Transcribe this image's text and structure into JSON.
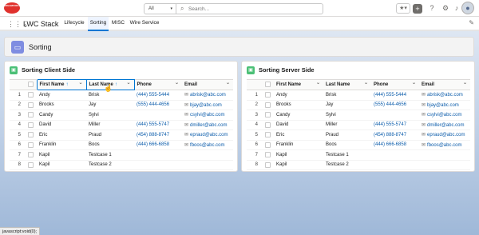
{
  "global_header": {
    "logo_text": "DREAMFORCE",
    "search_scope": "All",
    "search_placeholder": "Search...",
    "icons": [
      "star-icon",
      "chevron-down-icon",
      "plus-icon",
      "help-icon",
      "gear-icon",
      "bell-icon",
      "avatar"
    ]
  },
  "app_nav": {
    "app_name": "LWC Stack",
    "tabs": [
      {
        "label": "Lifecycle",
        "active": false
      },
      {
        "label": "Sorting",
        "active": true
      },
      {
        "label": "MISC",
        "active": false
      },
      {
        "label": "Wire Service",
        "active": false
      }
    ]
  },
  "page_header": {
    "title": "Sorting"
  },
  "cards": [
    {
      "title": "Sorting Client Side",
      "columns": [
        {
          "label": "First Name",
          "sorted": true,
          "arrow": "↑"
        },
        {
          "label": "Last Name",
          "sorted": true,
          "arrow": "↑"
        },
        {
          "label": "Phone",
          "sorted": false,
          "arrow": ""
        },
        {
          "label": "Email",
          "sorted": false,
          "arrow": ""
        }
      ],
      "rows": [
        {
          "num": "1",
          "first": "Andy",
          "last": "Brisk",
          "phone": "(444) 555-5444",
          "email": "abrisk@abc.com"
        },
        {
          "num": "2",
          "first": "Brooks",
          "last": "Jay",
          "phone": "(555) 444-4656",
          "email": "bjay@abc.com"
        },
        {
          "num": "3",
          "first": "Candy",
          "last": "Sylvi",
          "phone": "",
          "email": "csylvi@abc.com"
        },
        {
          "num": "4",
          "first": "David",
          "last": "Miller",
          "phone": "(444) 555-5747",
          "email": "dmiller@abc.com"
        },
        {
          "num": "5",
          "first": "Eric",
          "last": "Praud",
          "phone": "(454) 888-8747",
          "email": "epraud@abc.com"
        },
        {
          "num": "6",
          "first": "Franklin",
          "last": "Boos",
          "phone": "(444) 666-6858",
          "email": "fboos@abc.com"
        },
        {
          "num": "7",
          "first": "Kapil",
          "last": "Testcase 1",
          "phone": "",
          "email": ""
        },
        {
          "num": "8",
          "first": "Kapil",
          "last": "Testcase 2",
          "phone": "",
          "email": ""
        }
      ]
    },
    {
      "title": "Sorting Server Side",
      "columns": [
        {
          "label": "First Name",
          "sorted": false,
          "arrow": ""
        },
        {
          "label": "Last Name",
          "sorted": false,
          "arrow": ""
        },
        {
          "label": "Phone",
          "sorted": false,
          "arrow": ""
        },
        {
          "label": "Email",
          "sorted": false,
          "arrow": ""
        }
      ],
      "rows": [
        {
          "num": "1",
          "first": "Andy",
          "last": "Brisk",
          "phone": "(444) 555-5444",
          "email": "abrisk@abc.com"
        },
        {
          "num": "2",
          "first": "Brooks",
          "last": "Jay",
          "phone": "(555) 444-4656",
          "email": "bjay@abc.com"
        },
        {
          "num": "3",
          "first": "Candy",
          "last": "Sylvi",
          "phone": "",
          "email": "csylvi@abc.com"
        },
        {
          "num": "4",
          "first": "David",
          "last": "Miller",
          "phone": "(444) 555-5747",
          "email": "dmiller@abc.com"
        },
        {
          "num": "5",
          "first": "Eric",
          "last": "Praud",
          "phone": "(454) 888-8747",
          "email": "epraud@abc.com"
        },
        {
          "num": "6",
          "first": "Franklin",
          "last": "Boos",
          "phone": "(444) 666-6858",
          "email": "fboos@abc.com"
        },
        {
          "num": "7",
          "first": "Kapil",
          "last": "Testcase 1",
          "phone": "",
          "email": ""
        },
        {
          "num": "8",
          "first": "Kapil",
          "last": "Testcase 2",
          "phone": "",
          "email": ""
        }
      ]
    }
  ],
  "status_bar": {
    "text": "javascript:void(0);"
  },
  "colors": {
    "accent": "#0176d3",
    "link": "#0b5cab",
    "card_icon": "#4bc076",
    "page_icon": "#7f8de1"
  }
}
